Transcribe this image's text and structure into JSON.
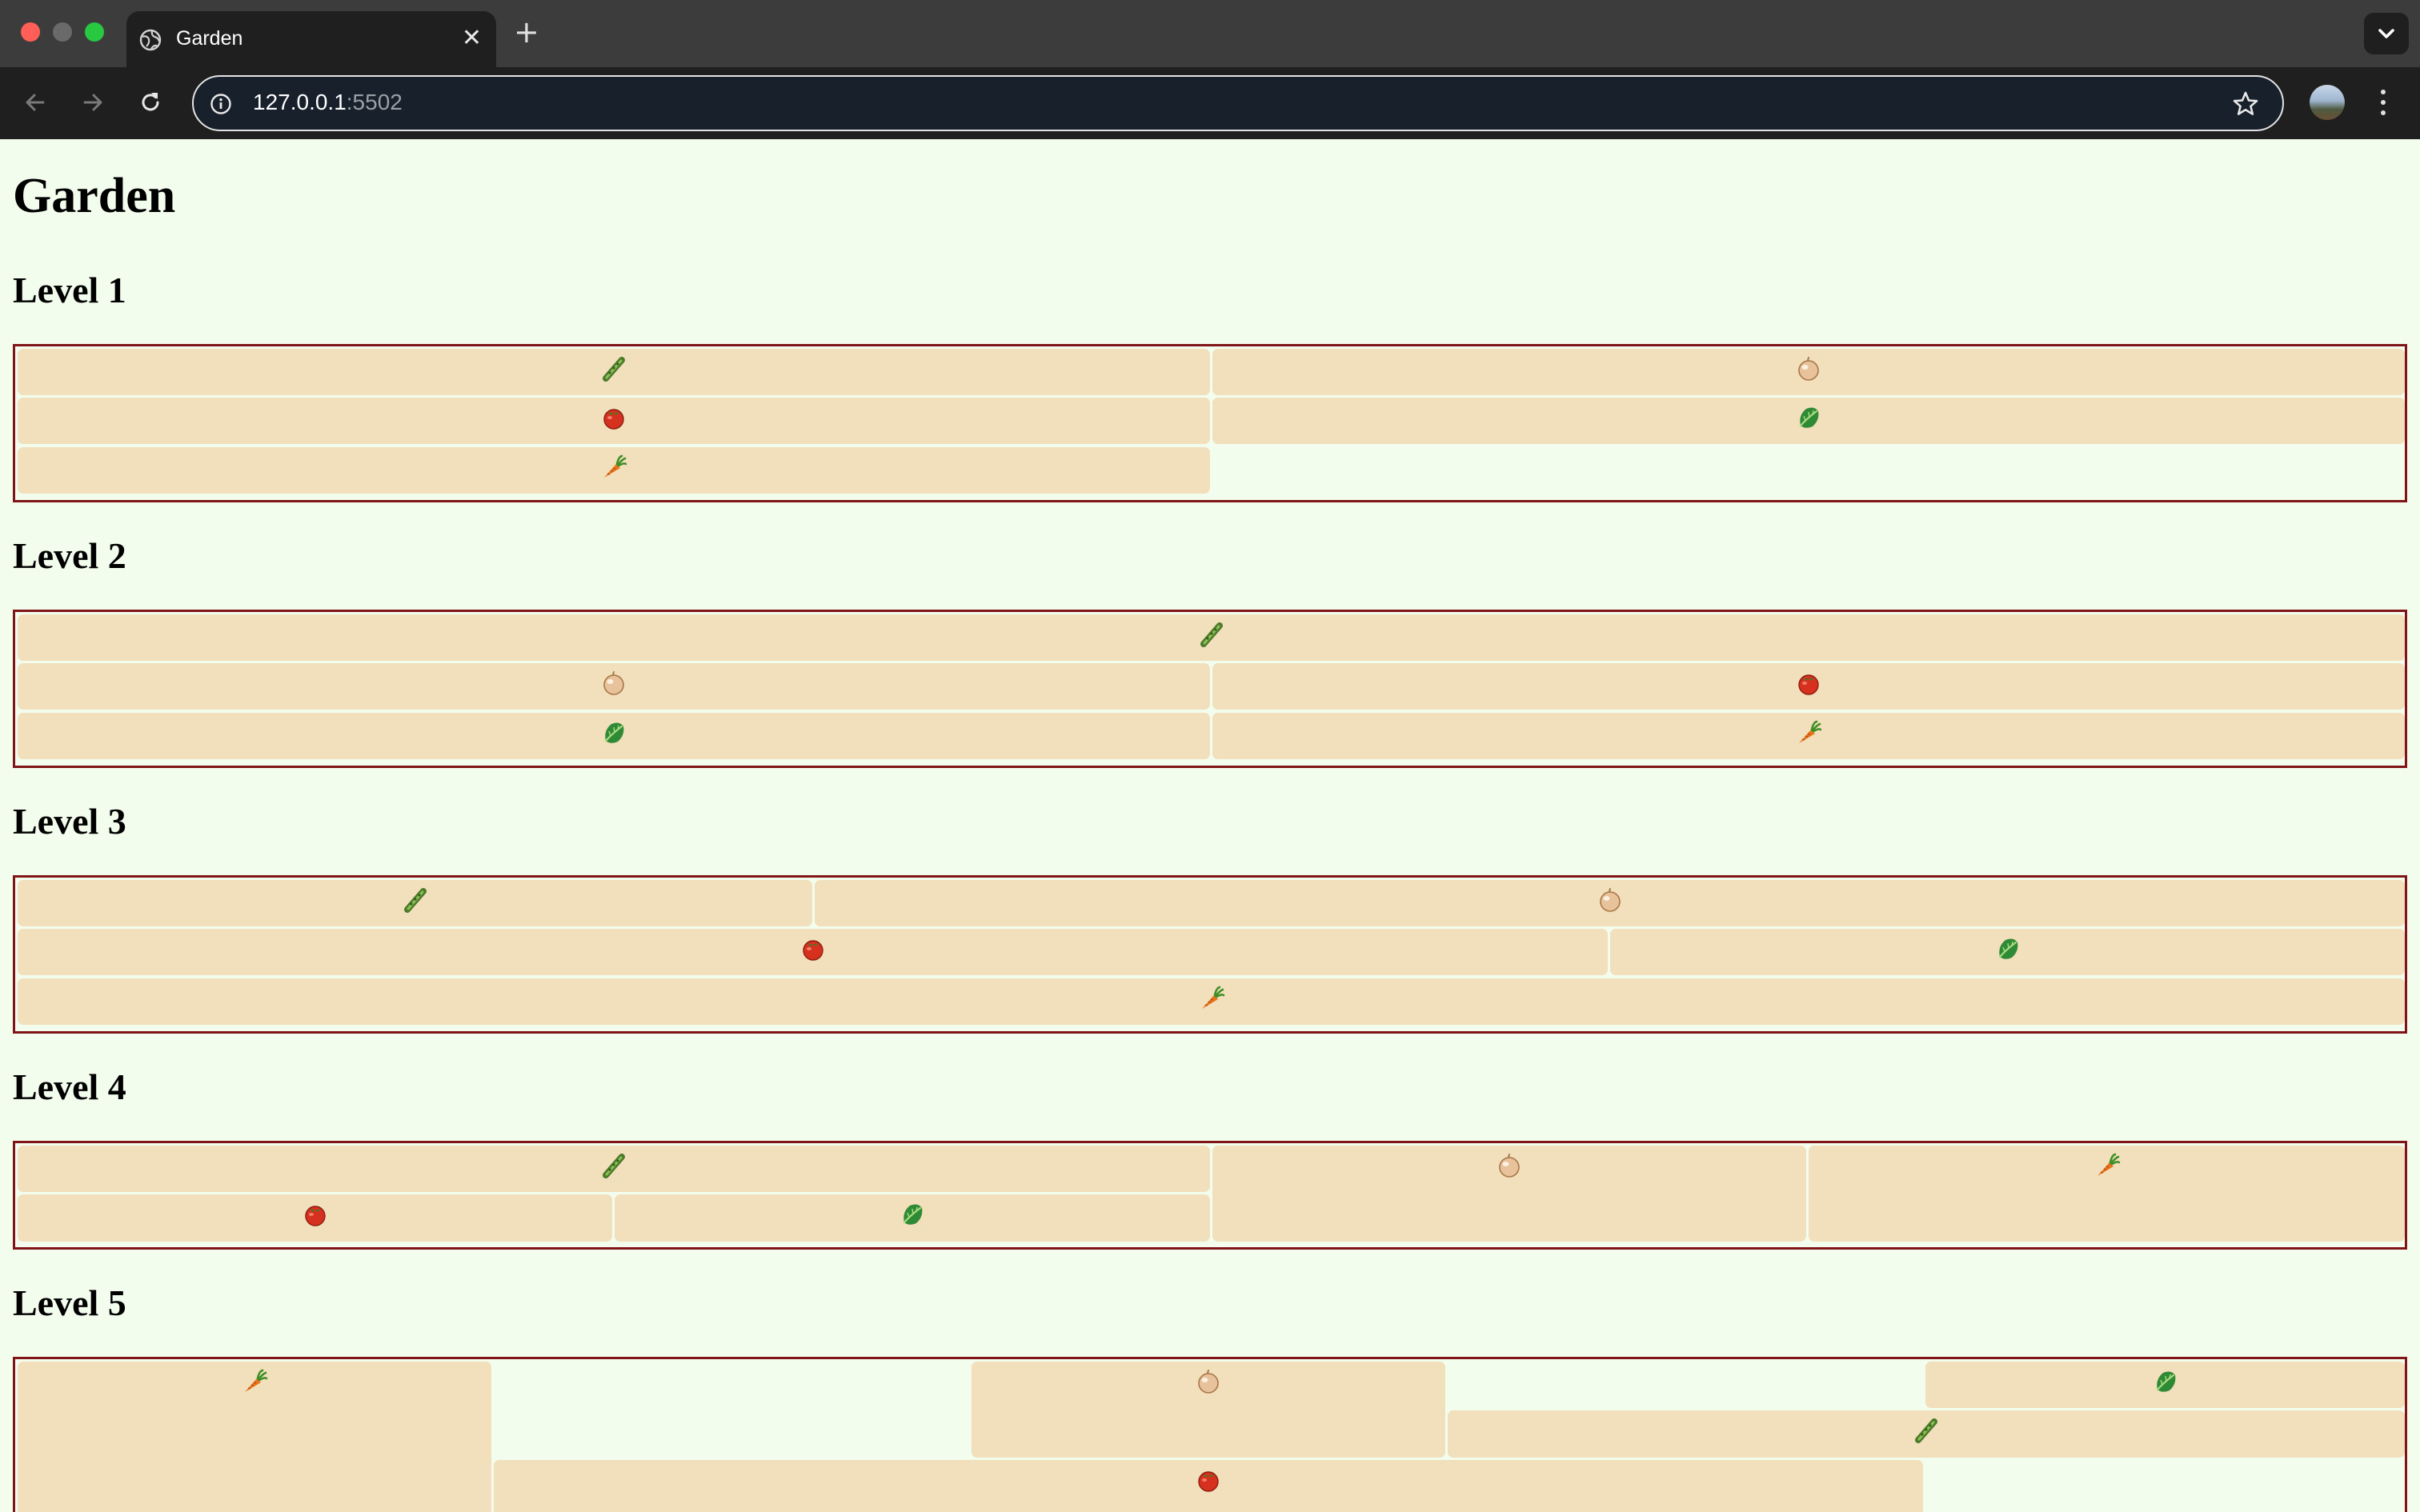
{
  "browser": {
    "tab_title": "Garden",
    "tab_close": "✕",
    "new_tab": "+",
    "url_host": "127.0.0.1",
    "url_port": ":5502"
  },
  "page": {
    "title": "Garden"
  },
  "levels": [
    {
      "title": "Level 1",
      "plots": [
        "asparagus",
        "onion",
        "tomato",
        "lettuce",
        "carrot"
      ]
    },
    {
      "title": "Level 2",
      "plots": [
        "asparagus",
        "onion",
        "tomato",
        "lettuce",
        "carrot"
      ]
    },
    {
      "title": "Level 3",
      "plots": [
        "asparagus",
        "onion",
        "tomato",
        "lettuce",
        "carrot"
      ]
    },
    {
      "title": "Level 4",
      "plots": [
        "asparagus",
        "onion",
        "carrot",
        "tomato",
        "lettuce"
      ]
    },
    {
      "title": "Level 5",
      "plots": [
        "carrot",
        "onion",
        "lettuce",
        "asparagus",
        "tomato"
      ]
    }
  ],
  "colors": {
    "page_background": "#f3fdee",
    "garden_border": "#801417",
    "plot_fill": "#f2dfbb"
  }
}
